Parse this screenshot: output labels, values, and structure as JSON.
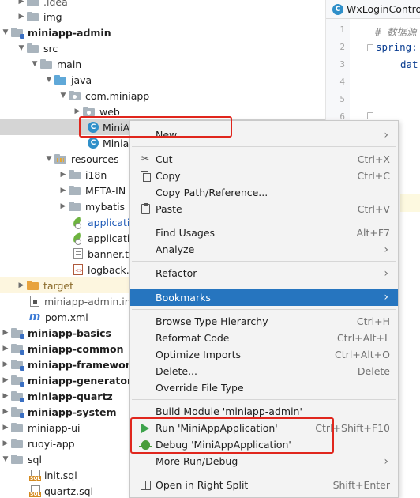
{
  "tree": {
    "idea": ".idea",
    "img": "img",
    "miniapp_admin": "miniapp-admin",
    "src": "src",
    "main": "main",
    "java": "java",
    "pkg": "com.miniapp",
    "web": "web",
    "cls1": "MiniAp",
    "cls2": "Miniap",
    "resources": "resources",
    "i18n": "i18n",
    "meta": "META-IN",
    "mybatis": "mybatis",
    "app1": "applicatio",
    "app2": "applicatio",
    "banner": "banner.tx",
    "logback": "logback.x",
    "target": "target",
    "iml": "miniapp-admin.iml",
    "pom": "pom.xml",
    "basics": "miniapp-basics",
    "common": "miniapp-common",
    "framework": "miniapp-framework",
    "generator": "miniapp-generator",
    "quartz": "miniapp-quartz",
    "system": "miniapp-system",
    "ui": "miniapp-ui",
    "ruoyi": "ruoyi-app",
    "sql": "sql",
    "init": "init.sql",
    "quartzsql": "quartz.sql"
  },
  "editor": {
    "tab_label": "WxLoginControl",
    "line_numbers": [
      "1",
      "2",
      "3",
      "4",
      "5",
      "6"
    ],
    "code_line1": "# 数据源",
    "code_line2": "spring:",
    "code_line3": "dat"
  },
  "menu": {
    "items": [
      {
        "label": "New",
        "shortcut": "",
        "submenu": true
      },
      {
        "label": "Cut",
        "shortcut": "Ctrl+X",
        "submenu": false
      },
      {
        "label": "Copy",
        "shortcut": "Ctrl+C",
        "submenu": false
      },
      {
        "label": "Copy Path/Reference...",
        "shortcut": "",
        "submenu": false
      },
      {
        "label": "Paste",
        "shortcut": "Ctrl+V",
        "submenu": false
      },
      {
        "label": "Find Usages",
        "shortcut": "Alt+F7",
        "submenu": false
      },
      {
        "label": "Analyze",
        "shortcut": "",
        "submenu": true
      },
      {
        "label": "Refactor",
        "shortcut": "",
        "submenu": true
      },
      {
        "label": "Bookmarks",
        "shortcut": "",
        "submenu": true
      },
      {
        "label": "Browse Type Hierarchy",
        "shortcut": "Ctrl+H",
        "submenu": false
      },
      {
        "label": "Reformat Code",
        "shortcut": "Ctrl+Alt+L",
        "submenu": false
      },
      {
        "label": "Optimize Imports",
        "shortcut": "Ctrl+Alt+O",
        "submenu": false
      },
      {
        "label": "Delete...",
        "shortcut": "Delete",
        "submenu": false
      },
      {
        "label": "Override File Type",
        "shortcut": "",
        "submenu": false
      },
      {
        "label": "Build Module 'miniapp-admin'",
        "shortcut": "",
        "submenu": false
      },
      {
        "label": "Run 'MiniAppApplication'",
        "shortcut": "Ctrl+Shift+F10",
        "submenu": false
      },
      {
        "label": "Debug 'MiniAppApplication'",
        "shortcut": "",
        "submenu": false
      },
      {
        "label": "More Run/Debug",
        "shortcut": "",
        "submenu": true
      },
      {
        "label": "Open in Right Split",
        "shortcut": "Shift+Enter",
        "submenu": false
      }
    ]
  },
  "colors": {
    "menu_active": "#2675bf",
    "annotation_red": "#e0261d",
    "selection_row": "#d5d5d5"
  }
}
